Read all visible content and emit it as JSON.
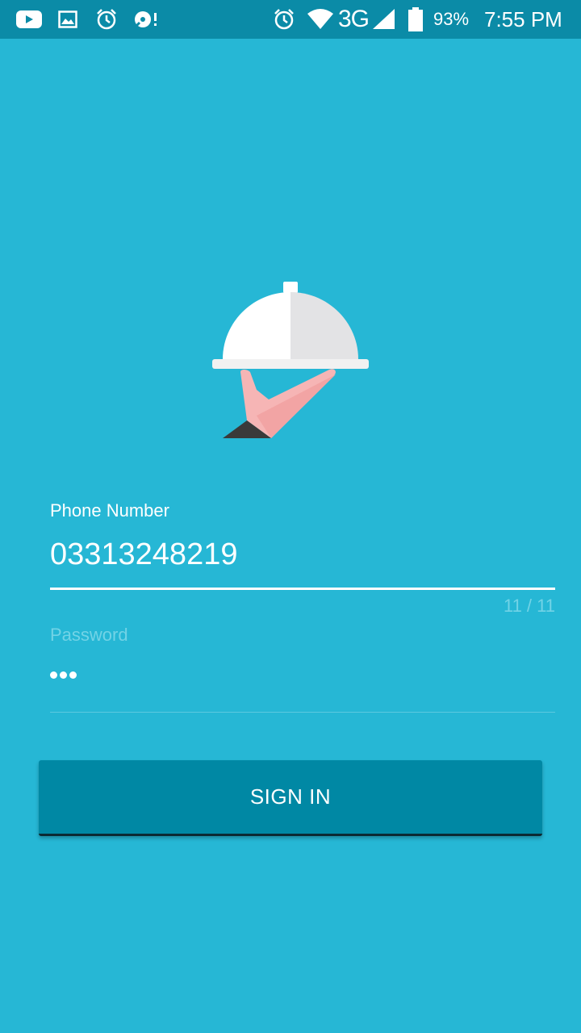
{
  "status_bar": {
    "icons_left": [
      "youtube-icon",
      "gallery-icon",
      "alarm-icon",
      "disc-alert-icon"
    ],
    "icons_right": [
      "alarm-icon",
      "wifi-icon",
      "cell-signal-icon",
      "battery-icon"
    ],
    "network": "3G",
    "battery_percent": "93%",
    "time": "7:55 PM"
  },
  "logo": {
    "icon": "serving-cloche-hand-icon"
  },
  "form": {
    "phone": {
      "label": "Phone Number",
      "value": "03313248219",
      "counter": "11 / 11"
    },
    "password": {
      "label": "Password",
      "masked_length": 3
    },
    "submit_label": "SIGN IN"
  },
  "colors": {
    "background": "#26b7d5",
    "status_bar": "#0b8ba7",
    "button": "#0088a4",
    "muted_text": "#72d3e6",
    "text": "#ffffff"
  }
}
